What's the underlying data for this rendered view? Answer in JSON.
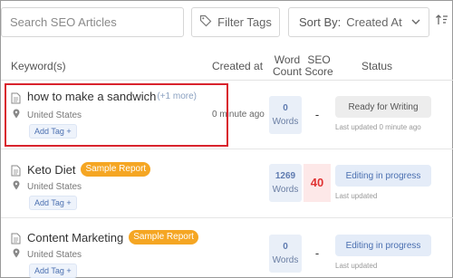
{
  "search": {
    "placeholder": "Search SEO Articles"
  },
  "filter": {
    "label": "Filter Tags",
    "icon": "tag-icon"
  },
  "sort": {
    "label": "Sort By:",
    "value": "Created At",
    "chevron_icon": "chevron-down-icon",
    "direction_icon": "sort-direction-icon"
  },
  "columns": {
    "keyword": "Keyword(s)",
    "created": "Created at",
    "word_count_1": "Word",
    "word_count_2": "Count",
    "seo_1": "SEO",
    "seo_2": "Score",
    "status": "Status"
  },
  "rows": [
    {
      "title": "how to make a sandwich",
      "more": "(+1 more)",
      "badge": "",
      "location": "United States",
      "tag_label": "Add Tag +",
      "created": "0 minute ago",
      "word_count": "0",
      "words_label": "Words",
      "seo_score": "-",
      "status": "Ready for Writing",
      "updated": "Last updated 0 minute ago"
    },
    {
      "title": "Keto Diet",
      "more": "",
      "badge": "Sample Report",
      "location": "United States",
      "tag_label": "Add Tag +",
      "created": "",
      "word_count": "1269",
      "words_label": "Words",
      "seo_score": "40",
      "status": "Editing in progress",
      "updated": "Last updated"
    },
    {
      "title": "Content Marketing",
      "more": "",
      "badge": "Sample Report",
      "location": "United States",
      "tag_label": "Add Tag +",
      "created": "",
      "word_count": "0",
      "words_label": "Words",
      "seo_score": "-",
      "status": "Editing in progress",
      "updated": "Last updated"
    }
  ],
  "colors": {
    "badge": "#f5a623",
    "highlight": "#d9232d",
    "seo_red": "#e03333",
    "accent_blue": "#4a6fb0"
  }
}
